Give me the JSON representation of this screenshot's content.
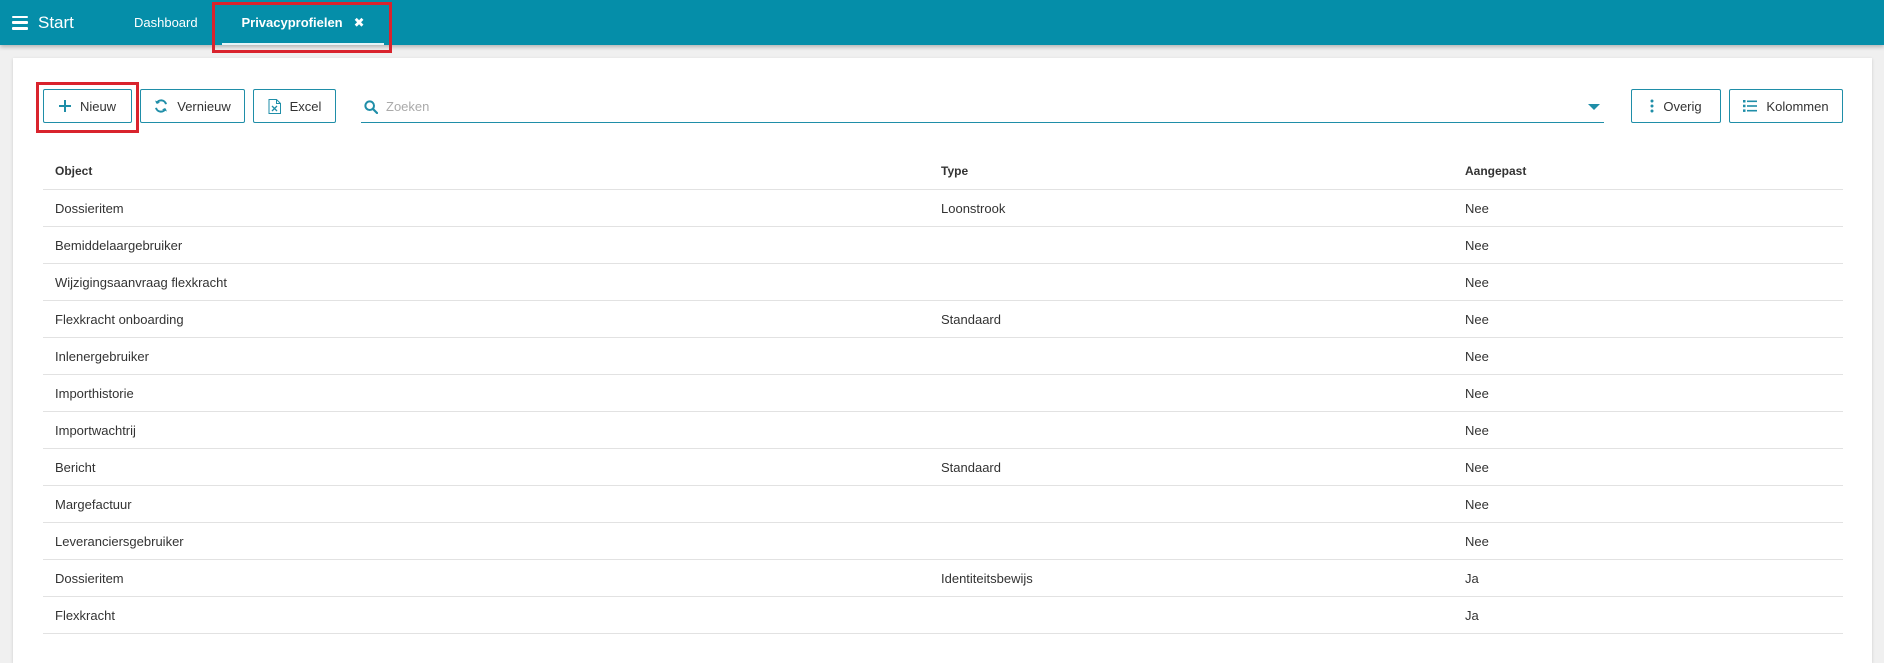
{
  "topbar": {
    "start_label": "Start",
    "tabs": [
      {
        "label": "Dashboard"
      },
      {
        "label": "Privacyprofielen",
        "close": "✖"
      }
    ]
  },
  "toolbar": {
    "new_label": "Nieuw",
    "refresh_label": "Vernieuw",
    "excel_label": "Excel",
    "other_label": "Overig",
    "columns_label": "Kolommen"
  },
  "search": {
    "placeholder": "Zoeken",
    "value": ""
  },
  "table": {
    "columns": [
      "Object",
      "Type",
      "Aangepast"
    ],
    "rows": [
      [
        "Dossieritem",
        "Loonstrook",
        "Nee"
      ],
      [
        "Bemiddelaargebruiker",
        "",
        "Nee"
      ],
      [
        "Wijzigingsaanvraag flexkracht",
        "",
        "Nee"
      ],
      [
        "Flexkracht onboarding",
        "Standaard",
        "Nee"
      ],
      [
        "Inlenergebruiker",
        "",
        "Nee"
      ],
      [
        "Importhistorie",
        "",
        "Nee"
      ],
      [
        "Importwachtrij",
        "",
        "Nee"
      ],
      [
        "Bericht",
        "Standaard",
        "Nee"
      ],
      [
        "Margefactuur",
        "",
        "Nee"
      ],
      [
        "Leveranciersgebruiker",
        "",
        "Nee"
      ],
      [
        "Dossieritem",
        "Identiteitsbewijs",
        "Ja"
      ],
      [
        "Flexkracht",
        "",
        "Ja"
      ]
    ]
  },
  "colors": {
    "brand": "#058ea9",
    "accent": "#1f8ea8",
    "highlight": "#d9232d"
  },
  "icons": {
    "menu": "hamburger-icon",
    "close": "close-icon",
    "new": "plus-icon",
    "refresh": "refresh-icon",
    "excel": "excel-file-icon",
    "search": "search-icon",
    "dropdown": "caret-down-icon",
    "other": "more-vertical-icon",
    "columns": "list-columns-icon"
  }
}
